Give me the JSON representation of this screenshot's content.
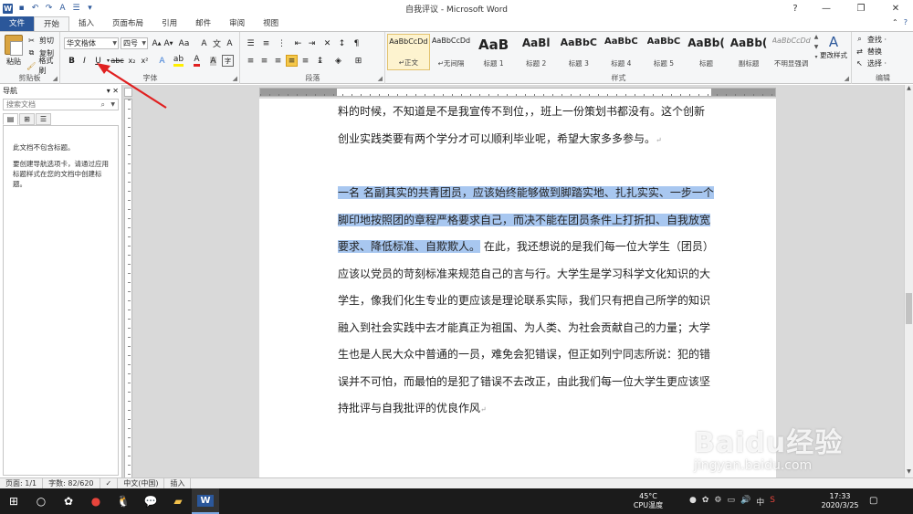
{
  "window": {
    "title": "自我评议 - Microsoft Word",
    "controls": [
      "?",
      "—",
      "❐",
      "✕"
    ]
  },
  "ribbon_tabs": [
    "文件",
    "开始",
    "插入",
    "页面布局",
    "引用",
    "邮件",
    "审阅",
    "视图"
  ],
  "clipboard": {
    "paste": "粘贴",
    "cut": "剪切",
    "copy": "复制",
    "format_painter": "格式刷",
    "label": "剪贴板"
  },
  "font": {
    "name": "华文楷体",
    "size": "四号",
    "label": "字体"
  },
  "paragraph": {
    "label": "段落"
  },
  "styles": {
    "label": "样式",
    "items": [
      {
        "preview": "AaBbCcDd",
        "name": "↵正文"
      },
      {
        "preview": "AaBbCcDd",
        "name": "↵无间隔"
      },
      {
        "preview": "AaB",
        "name": "标题 1"
      },
      {
        "preview": "AaBl",
        "name": "标题 2"
      },
      {
        "preview": "AaBbC",
        "name": "标题 3"
      },
      {
        "preview": "AaBbC",
        "name": "标题 4"
      },
      {
        "preview": "AaBbC",
        "name": "标题 5"
      },
      {
        "preview": "AaBb(",
        "name": "标题"
      },
      {
        "preview": "AaBb(",
        "name": "副标题"
      },
      {
        "preview": "AaBbCcDd",
        "name": "不明显强调"
      }
    ],
    "change_styles": "更改样式"
  },
  "editing": {
    "find": "查找 ·",
    "replace": "替换",
    "select": "选择 ·",
    "label": "编辑"
  },
  "nav": {
    "title": "导航",
    "search_placeholder": "搜索文档",
    "msg1": "此文档不包含标题。",
    "msg2": "要创建导航选项卡，请通过应用标题样式在您的文档中创建标题。"
  },
  "document": {
    "para1": "料的时候，不知道是不是我宣传不到位，，班上一份策划书都没有。这个创新创业实践类要有两个学分才可以顺利毕业呢，希望大家多多参与。",
    "para2_highlighted": "一名 名副其实的共青团员，应该始终能够做到脚踏实地、扎扎实实、一步一个脚印地按照团的章程严格要求自己，而决不能在团员条件上打折扣、自我放宽要求、降低标准、自欺欺人。",
    "para2_rest": "在此，我还想说的是我们每一位大学生（团员）应该以党员的苛刻标准来规范自己的言与行。大学生是学习科学文化知识的大学生，像我们化生专业的更应该是理论联系实际，我们只有把自己所学的知识融入到社会实践中去才能真正为祖国、为人类、为社会贡献自己的力量；大学生也是人民大众中普通的一员，难免会犯错误，但正如列宁同志所说：犯的错误并不可怕，而最怕的是犯了错误不去改正，由此我们每一位大学生更应该坚持批评与自我批评的优良作风"
  },
  "status": {
    "page": "页面: 1/1",
    "words": "字数: 82/620",
    "lang": "中文(中国)",
    "mode": "插入"
  },
  "taskbar": {
    "temp": "45°C",
    "temp_label": "CPU温度",
    "time": "17:33",
    "date": "2020/3/25",
    "ime": "中"
  },
  "watermark": {
    "brand": "Baidu经验",
    "url": "jingyan.baidu.com"
  },
  "colors": {
    "accent": "#2b579a",
    "highlight": "#a8c7f0",
    "annotation": "#e02020"
  }
}
